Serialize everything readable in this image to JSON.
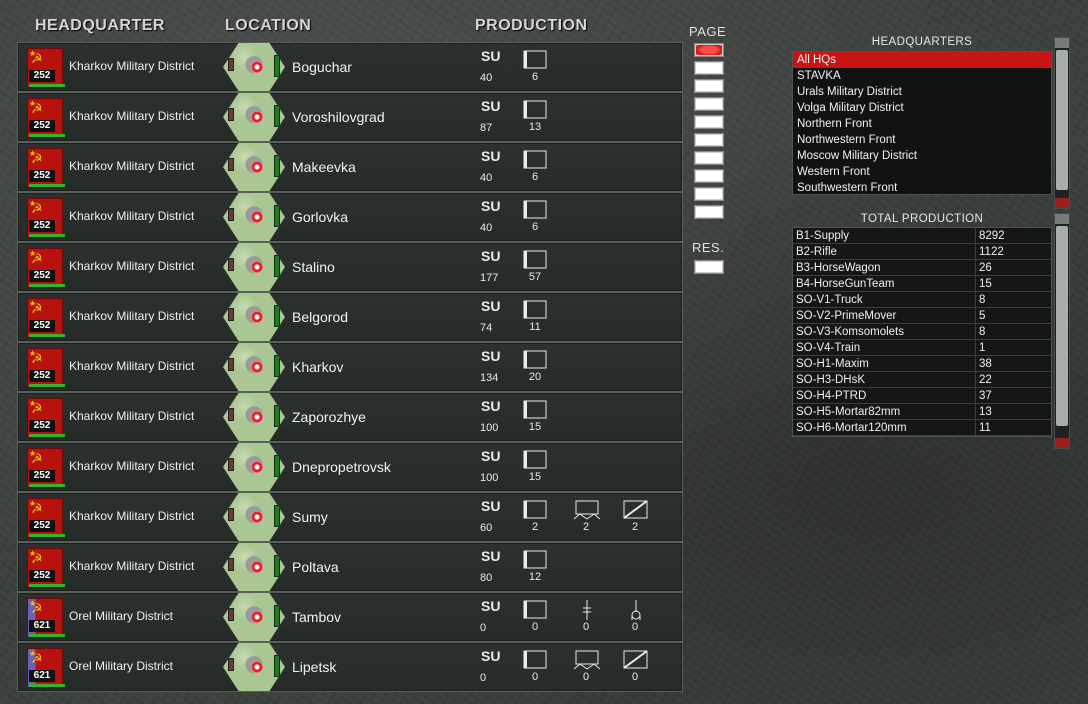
{
  "headers": {
    "hq": "HEADQUARTER",
    "location": "LOCATION",
    "production": "PRODUCTION"
  },
  "rows": [
    {
      "hq": "Kharkov Military District",
      "hq_num": "252",
      "flag": "kharkov",
      "location": "Boguchar",
      "su": "SU",
      "su_val": "40",
      "units": [
        {
          "icon": "infantry-box-icon",
          "val": "6"
        }
      ]
    },
    {
      "hq": "Kharkov Military District",
      "hq_num": "252",
      "flag": "kharkov",
      "location": "Voroshilovgrad",
      "su": "SU",
      "su_val": "87",
      "units": [
        {
          "icon": "infantry-box-icon",
          "val": "13"
        }
      ]
    },
    {
      "hq": "Kharkov Military District",
      "hq_num": "252",
      "flag": "kharkov",
      "location": "Makeevka",
      "su": "SU",
      "su_val": "40",
      "units": [
        {
          "icon": "infantry-box-icon",
          "val": "6"
        }
      ]
    },
    {
      "hq": "Kharkov Military District",
      "hq_num": "252",
      "flag": "kharkov",
      "location": "Gorlovka",
      "su": "SU",
      "su_val": "40",
      "units": [
        {
          "icon": "infantry-box-icon",
          "val": "6"
        }
      ]
    },
    {
      "hq": "Kharkov Military District",
      "hq_num": "252",
      "flag": "kharkov",
      "location": "Stalino",
      "su": "SU",
      "su_val": "177",
      "units": [
        {
          "icon": "infantry-box-icon",
          "val": "57"
        }
      ]
    },
    {
      "hq": "Kharkov Military District",
      "hq_num": "252",
      "flag": "kharkov",
      "location": "Belgorod",
      "su": "SU",
      "su_val": "74",
      "units": [
        {
          "icon": "infantry-box-icon",
          "val": "11"
        }
      ]
    },
    {
      "hq": "Kharkov Military District",
      "hq_num": "252",
      "flag": "kharkov",
      "location": "Kharkov",
      "su": "SU",
      "su_val": "134",
      "units": [
        {
          "icon": "infantry-box-icon",
          "val": "20"
        }
      ]
    },
    {
      "hq": "Kharkov Military District",
      "hq_num": "252",
      "flag": "kharkov",
      "location": "Zaporozhye",
      "su": "SU",
      "su_val": "100",
      "units": [
        {
          "icon": "infantry-box-icon",
          "val": "15"
        }
      ]
    },
    {
      "hq": "Kharkov Military District",
      "hq_num": "252",
      "flag": "kharkov",
      "location": "Dnepropetrovsk",
      "su": "SU",
      "su_val": "100",
      "units": [
        {
          "icon": "infantry-box-icon",
          "val": "15"
        }
      ]
    },
    {
      "hq": "Kharkov Military District",
      "hq_num": "252",
      "flag": "kharkov",
      "location": "Sumy",
      "su": "SU",
      "su_val": "60",
      "units": [
        {
          "icon": "infantry-box-icon",
          "val": "2"
        },
        {
          "icon": "horse-wagon-icon",
          "val": "2"
        },
        {
          "icon": "antitank-box-icon",
          "val": "2"
        }
      ]
    },
    {
      "hq": "Kharkov Military District",
      "hq_num": "252",
      "flag": "kharkov",
      "location": "Poltava",
      "su": "SU",
      "su_val": "80",
      "units": [
        {
          "icon": "infantry-box-icon",
          "val": "12"
        }
      ]
    },
    {
      "hq": "Orel Military District",
      "hq_num": "621",
      "flag": "orel",
      "location": "Tambov",
      "su": "SU",
      "su_val": "0",
      "units": [
        {
          "icon": "infantry-box-icon",
          "val": "0"
        },
        {
          "icon": "machinegun-icon",
          "val": "0"
        },
        {
          "icon": "mortar-icon",
          "val": "0"
        }
      ]
    },
    {
      "hq": "Orel Military District",
      "hq_num": "621",
      "flag": "orel",
      "location": "Lipetsk",
      "su": "SU",
      "su_val": "0",
      "units": [
        {
          "icon": "infantry-box-icon",
          "val": "0"
        },
        {
          "icon": "horse-wagon-icon",
          "val": "0"
        },
        {
          "icon": "antitank-box-icon",
          "val": "0"
        }
      ]
    }
  ],
  "page": {
    "label": "PAGE",
    "buttons": 10,
    "active_index": 0,
    "res_label": "RES."
  },
  "hq_panel": {
    "title": "HEADQUARTERS",
    "items": [
      "All HQs",
      "STAVKA",
      "Urals Military District",
      "Volga Military District",
      "Northern Front",
      "Northwestern Front",
      "Moscow Military District",
      "Western Front",
      "Southwestern Front"
    ],
    "selected_index": 0
  },
  "prod_panel": {
    "title": "TOTAL PRODUCTION",
    "rows": [
      [
        "B1-Supply",
        "8292"
      ],
      [
        "B2-Rifle",
        "1122"
      ],
      [
        "B3-HorseWagon",
        "26"
      ],
      [
        "B4-HorseGunTeam",
        "15"
      ],
      [
        "SO-V1-Truck",
        "8"
      ],
      [
        "SO-V2-PrimeMover",
        "5"
      ],
      [
        "SO-V3-Komsomolets",
        "8"
      ],
      [
        "SO-V4-Train",
        "1"
      ],
      [
        "SO-H1-Maxim",
        "38"
      ],
      [
        "SO-H3-DHsK",
        "22"
      ],
      [
        "SO-H4-PTRD",
        "37"
      ],
      [
        "SO-H5-Mortar82mm",
        "13"
      ],
      [
        "SO-H6-Mortar120mm",
        "11"
      ]
    ]
  },
  "colors": {
    "selected": "#c81414",
    "soviet_red": "#b8120f",
    "gold": "#f2c51a",
    "supply_green": "#2fb52f"
  }
}
